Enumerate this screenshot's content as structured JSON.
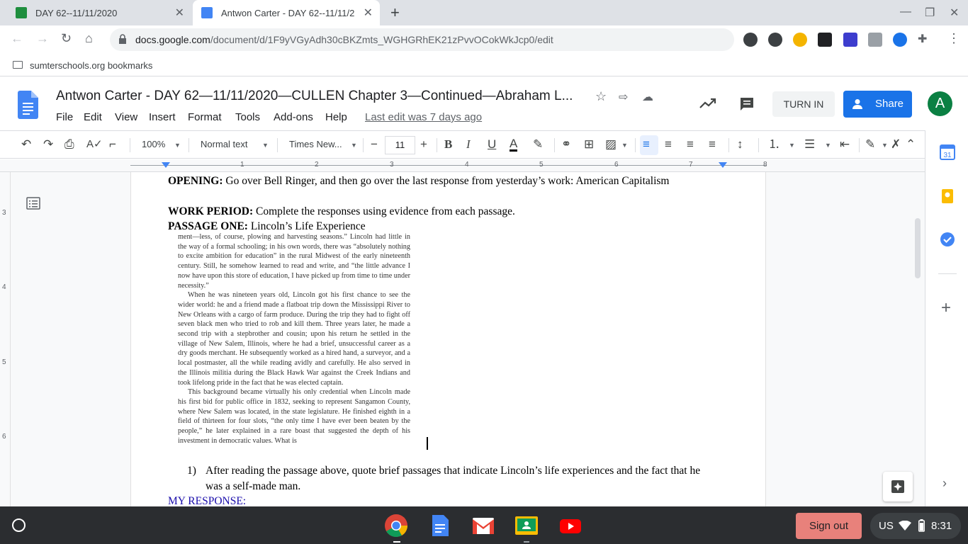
{
  "browser": {
    "tabs": [
      {
        "title": "DAY 62--11/11/2020",
        "favicon": "classroom-icon",
        "active": false
      },
      {
        "title": "Antwon Carter - DAY 62--11/11/2",
        "favicon": "docs-icon",
        "active": true
      }
    ],
    "url_host": "docs.google.com",
    "url_path": "/document/d/1F9yVGyAdh30cBKZmts_WGHGRhEK21zPvvOCokWkJcp0/edit",
    "bookmark_folder": "sumterschools.org bookmarks"
  },
  "docs": {
    "title": "Antwon Carter - DAY 62—11/11/2020—CULLEN Chapter 3—Continued—Abraham L...",
    "menu": [
      "File",
      "Edit",
      "View",
      "Insert",
      "Format",
      "Tools",
      "Add-ons",
      "Help"
    ],
    "last_edit": "Last edit was 7 days ago",
    "turn_in": "TURN IN",
    "share": "Share",
    "avatar_letter": "A",
    "brand_color": "#1a73e8"
  },
  "toolbar": {
    "zoom": "100%",
    "style": "Normal text",
    "font": "Times New...",
    "font_size": "11"
  },
  "ruler": {
    "numbers": [
      "1",
      "2",
      "3",
      "4",
      "5",
      "6",
      "7",
      "8"
    ],
    "vertical": [
      "3",
      "4",
      "5",
      "6"
    ]
  },
  "document": {
    "opening_label": "OPENING:",
    "opening_text": " Go over Bell Ringer, and then go over the last response from yesterday’s work:  American Capitalism",
    "work_label": "WORK PERIOD:",
    "work_text": "  Complete the responses using evidence from each passage.",
    "passage_label": "PASSAGE ONE:",
    "passage_text": "  Lincoln’s Life Experience",
    "scan_paragraphs": [
      "ment—less, of course, plowing and harvesting seasons.” Lincoln had little in the way of a formal schooling; in his own words, there was “absolutely nothing to excite ambition for education” in the rural Midwest of the early nineteenth century. Still, he somehow learned to read and write, and “the little advance I now have upon this store of education, I have picked up from time to time under necessity.”",
      "When he was nineteen years old, Lincoln got his first chance to see the wider world: he and a friend made a flatboat trip down the Mississippi River to New Orleans with a cargo of farm produce. During the trip they had to fight off seven black men who tried to rob and kill them. Three years later, he made a second trip with a stepbrother and cousin; upon his return he settled in the village of New Salem, Illinois, where he had a brief, unsuccessful career as a dry goods merchant. He subsequently worked as a hired hand, a surveyor, and a local postmaster, all the while reading avidly and carefully. He also served in the Illinois militia during the Black Hawk War against the Creek Indians and took lifelong pride in the fact that he was elected captain.",
      "This background became virtually his only credential when Lincoln made his first bid for public office in 1832, seeking to represent Sangamon County, where New Salem was located, in the state legislature. He finished eighth in a field of thirteen for four slots, “the only time I have ever been beaten by the people,” he later explained in a rare boast that suggested the depth of his investment in democratic values. What is"
    ],
    "question_number": "1)",
    "question_line1": "After reading the passage above, quote brief passages that indicate Lincoln’s life experiences and the fact that he",
    "question_line2": "was a self-made man.",
    "response_label": "MY RESPONSE:",
    "response_color": "#1a0dab"
  },
  "shelf": {
    "apps": [
      "chrome-icon",
      "docs-icon",
      "gmail-icon",
      "classroom-icon",
      "youtube-icon"
    ],
    "sign_out": "Sign out",
    "locale": "US",
    "time": "8:31"
  }
}
